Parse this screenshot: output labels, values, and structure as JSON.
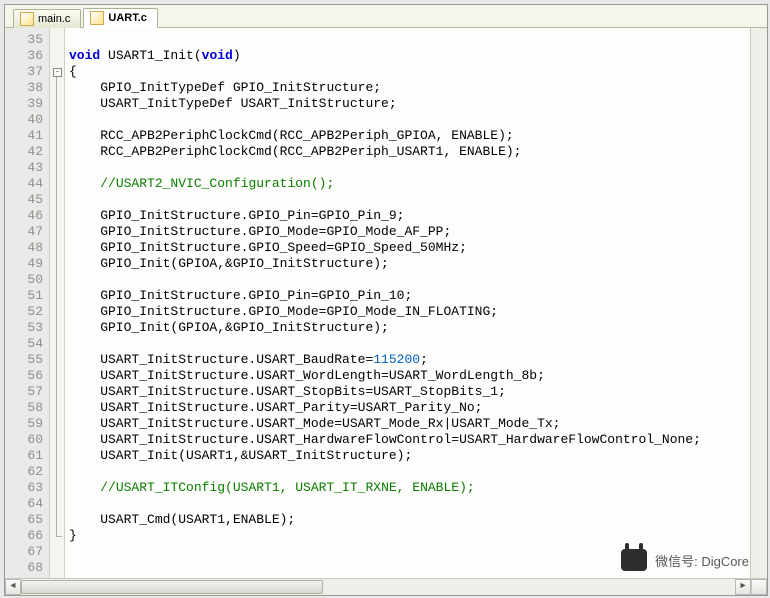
{
  "tabs": [
    {
      "label": "main.c",
      "active": false
    },
    {
      "label": "UART.c",
      "active": true
    }
  ],
  "first_line": 35,
  "code_lines": [
    {
      "n": 35,
      "segs": []
    },
    {
      "n": 36,
      "segs": [
        {
          "t": "void",
          "c": "kw"
        },
        {
          "t": " USART1_Init("
        },
        {
          "t": "void",
          "c": "kw"
        },
        {
          "t": ")"
        }
      ]
    },
    {
      "n": 37,
      "segs": [
        {
          "t": "{"
        }
      ],
      "fold": "open"
    },
    {
      "n": 38,
      "segs": [
        {
          "t": "    GPIO_InitTypeDef GPIO_InitStructure;"
        }
      ]
    },
    {
      "n": 39,
      "segs": [
        {
          "t": "    USART_InitTypeDef USART_InitStructure;"
        }
      ]
    },
    {
      "n": 40,
      "segs": []
    },
    {
      "n": 41,
      "segs": [
        {
          "t": "    RCC_APB2PeriphClockCmd(RCC_APB2Periph_GPIOA, ENABLE);"
        }
      ]
    },
    {
      "n": 42,
      "segs": [
        {
          "t": "    RCC_APB2PeriphClockCmd(RCC_APB2Periph_USART1, ENABLE);"
        }
      ]
    },
    {
      "n": 43,
      "segs": []
    },
    {
      "n": 44,
      "segs": [
        {
          "t": "    "
        },
        {
          "t": "//USART2_NVIC_Configuration();",
          "c": "cmt"
        }
      ]
    },
    {
      "n": 45,
      "segs": []
    },
    {
      "n": 46,
      "segs": [
        {
          "t": "    GPIO_InitStructure.GPIO_Pin=GPIO_Pin_9;"
        }
      ]
    },
    {
      "n": 47,
      "segs": [
        {
          "t": "    GPIO_InitStructure.GPIO_Mode=GPIO_Mode_AF_PP;"
        }
      ]
    },
    {
      "n": 48,
      "segs": [
        {
          "t": "    GPIO_InitStructure.GPIO_Speed=GPIO_Speed_50MHz;"
        }
      ]
    },
    {
      "n": 49,
      "segs": [
        {
          "t": "    GPIO_Init(GPIOA,&GPIO_InitStructure);"
        }
      ]
    },
    {
      "n": 50,
      "segs": []
    },
    {
      "n": 51,
      "segs": [
        {
          "t": "    GPIO_InitStructure.GPIO_Pin=GPIO_Pin_10;"
        }
      ]
    },
    {
      "n": 52,
      "segs": [
        {
          "t": "    GPIO_InitStructure.GPIO_Mode=GPIO_Mode_IN_FLOATING;"
        }
      ]
    },
    {
      "n": 53,
      "segs": [
        {
          "t": "    GPIO_Init(GPIOA,&GPIO_InitStructure);"
        }
      ]
    },
    {
      "n": 54,
      "segs": []
    },
    {
      "n": 55,
      "segs": [
        {
          "t": "    USART_InitStructure.USART_BaudRate="
        },
        {
          "t": "115200",
          "c": "num"
        },
        {
          "t": ";"
        }
      ]
    },
    {
      "n": 56,
      "segs": [
        {
          "t": "    USART_InitStructure.USART_WordLength=USART_WordLength_8b;"
        }
      ]
    },
    {
      "n": 57,
      "segs": [
        {
          "t": "    USART_InitStructure.USART_StopBits=USART_StopBits_1;"
        }
      ]
    },
    {
      "n": 58,
      "segs": [
        {
          "t": "    USART_InitStructure.USART_Parity=USART_Parity_No;"
        }
      ]
    },
    {
      "n": 59,
      "segs": [
        {
          "t": "    USART_InitStructure.USART_Mode=USART_Mode_Rx|USART_Mode_Tx;"
        }
      ]
    },
    {
      "n": 60,
      "segs": [
        {
          "t": "    USART_InitStructure.USART_HardwareFlowControl=USART_HardwareFlowControl_None;"
        }
      ]
    },
    {
      "n": 61,
      "segs": [
        {
          "t": "    USART_Init(USART1,&USART_InitStructure);"
        }
      ]
    },
    {
      "n": 62,
      "segs": []
    },
    {
      "n": 63,
      "segs": [
        {
          "t": "    "
        },
        {
          "t": "//USART_ITConfig(USART1, USART_IT_RXNE, ENABLE);",
          "c": "cmt"
        }
      ]
    },
    {
      "n": 64,
      "segs": []
    },
    {
      "n": 65,
      "segs": [
        {
          "t": "    USART_Cmd(USART1,ENABLE);"
        }
      ]
    },
    {
      "n": 66,
      "segs": [
        {
          "t": "}"
        }
      ],
      "fold": "close"
    },
    {
      "n": 67,
      "segs": []
    },
    {
      "n": 68,
      "segs": []
    }
  ],
  "watermark": {
    "label": "微信号",
    "value": "DigCore"
  }
}
